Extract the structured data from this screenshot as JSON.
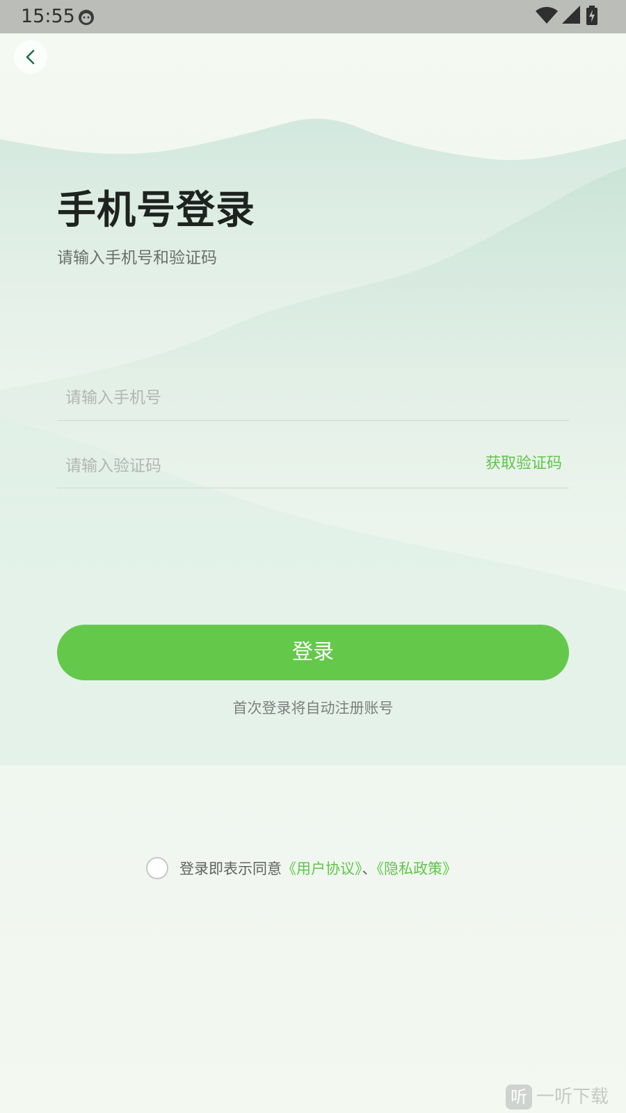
{
  "status_bar": {
    "time": "15:55",
    "icons": [
      "cat-notification-icon",
      "wifi-icon",
      "signal-icon",
      "battery-charging-icon"
    ]
  },
  "nav": {
    "back_icon": "chevron-left-icon"
  },
  "header": {
    "title": "手机号登录",
    "subtitle": "请输入手机号和验证码"
  },
  "form": {
    "phone_placeholder": "请输入手机号",
    "phone_value": "",
    "code_placeholder": "请输入验证码",
    "code_value": "",
    "get_code_label": "获取验证码"
  },
  "login": {
    "button_label": "登录",
    "auto_register_note": "首次登录将自动注册账号"
  },
  "agreement": {
    "checked": false,
    "prefix": "登录即表示同意",
    "user_agreement": "《用户协议》",
    "separator": "、",
    "privacy_policy": "《隐私政策》"
  },
  "watermark": {
    "icon_char": "听",
    "text": "一听下载"
  },
  "colors": {
    "accent": "#64c94a",
    "link": "#5fc54a",
    "status_bar": "#bbbdb8",
    "background": "#f3f8f0"
  }
}
